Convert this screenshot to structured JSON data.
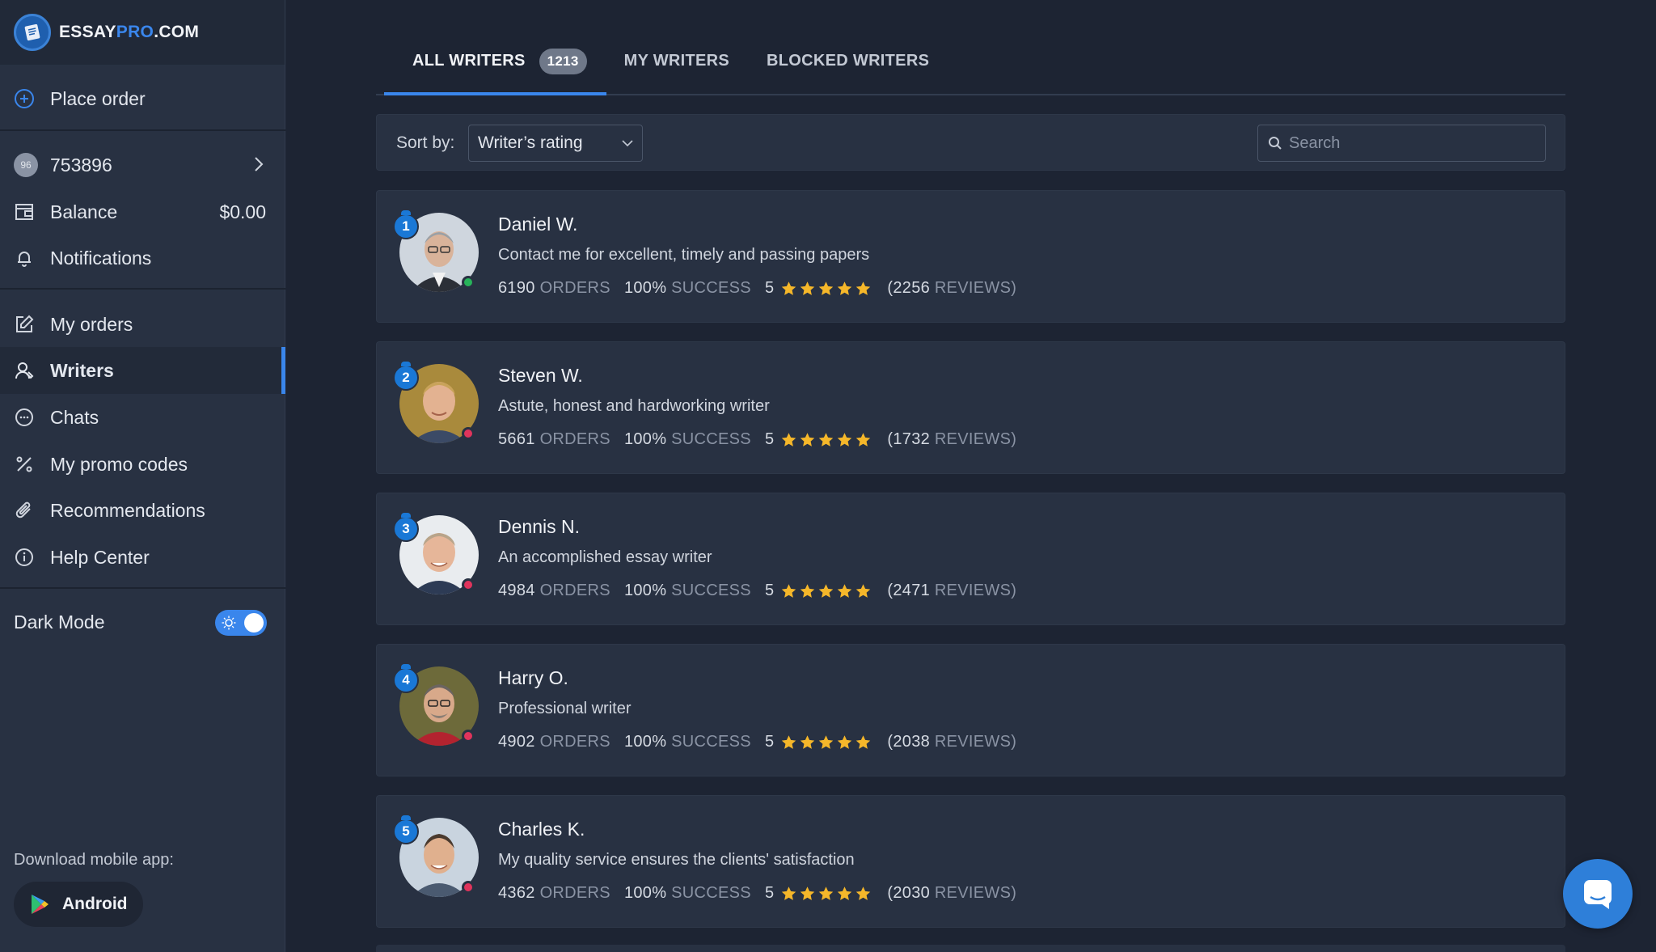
{
  "brand": {
    "name_part1": "ESSAY",
    "name_part2": "PRO",
    "name_part3": ".COM"
  },
  "sidebar": {
    "place_order": "Place order",
    "account": {
      "avatar_text": "96",
      "id": "753896"
    },
    "balance": {
      "label": "Balance",
      "value": "$0.00"
    },
    "notifications": "Notifications",
    "items": [
      {
        "label": "My orders",
        "icon": "edit-icon"
      },
      {
        "label": "Writers",
        "icon": "writers-icon",
        "active": true
      },
      {
        "label": "Chats",
        "icon": "chat-bubble-icon"
      },
      {
        "label": "My promo codes",
        "icon": "percent-icon"
      },
      {
        "label": "Recommendations",
        "icon": "paperclip-icon"
      },
      {
        "label": "Help Center",
        "icon": "info-icon"
      }
    ],
    "dark_mode": {
      "label": "Dark Mode",
      "enabled": true
    },
    "mobile_app": {
      "label": "Download mobile app:",
      "android": "Android"
    }
  },
  "tabs": [
    {
      "label": "ALL WRITERS",
      "count": "1213",
      "active": true
    },
    {
      "label": "MY WRITERS"
    },
    {
      "label": "BLOCKED WRITERS"
    }
  ],
  "toolbar": {
    "sort_label": "Sort by:",
    "sort_value": "Writer’s rating",
    "search_placeholder": "Search"
  },
  "writers": [
    {
      "rank": "1",
      "name": "Daniel W.",
      "bio": "Contact me for excellent, timely and passing papers",
      "orders": "6190",
      "orders_label": "ORDERS",
      "success": "100%",
      "success_label": "SUCCESS",
      "rating": "5",
      "reviews_open": "(2256",
      "reviews_label": "REVIEWS)",
      "status": "online"
    },
    {
      "rank": "2",
      "name": "Steven W.",
      "bio": "Astute, honest and hardworking writer",
      "orders": "5661",
      "orders_label": "ORDERS",
      "success": "100%",
      "success_label": "SUCCESS",
      "rating": "5",
      "reviews_open": "(1732",
      "reviews_label": "REVIEWS)",
      "status": "offline"
    },
    {
      "rank": "3",
      "name": "Dennis N.",
      "bio": "An accomplished essay writer",
      "orders": "4984",
      "orders_label": "ORDERS",
      "success": "100%",
      "success_label": "SUCCESS",
      "rating": "5",
      "reviews_open": "(2471",
      "reviews_label": "REVIEWS)",
      "status": "offline"
    },
    {
      "rank": "4",
      "name": "Harry O.",
      "bio": "Professional writer",
      "orders": "4902",
      "orders_label": "ORDERS",
      "success": "100%",
      "success_label": "SUCCESS",
      "rating": "5",
      "reviews_open": "(2038",
      "reviews_label": "REVIEWS)",
      "status": "offline"
    },
    {
      "rank": "5",
      "name": "Charles K.",
      "bio": "My quality service ensures the clients' satisfaction",
      "orders": "4362",
      "orders_label": "ORDERS",
      "success": "100%",
      "success_label": "SUCCESS",
      "rating": "5",
      "reviews_open": "(2030",
      "reviews_label": "REVIEWS)",
      "status": "offline"
    }
  ],
  "colors": {
    "accent": "#3a86ec",
    "star": "#f5b72a",
    "online": "#27b35a",
    "offline": "#e0345c"
  }
}
